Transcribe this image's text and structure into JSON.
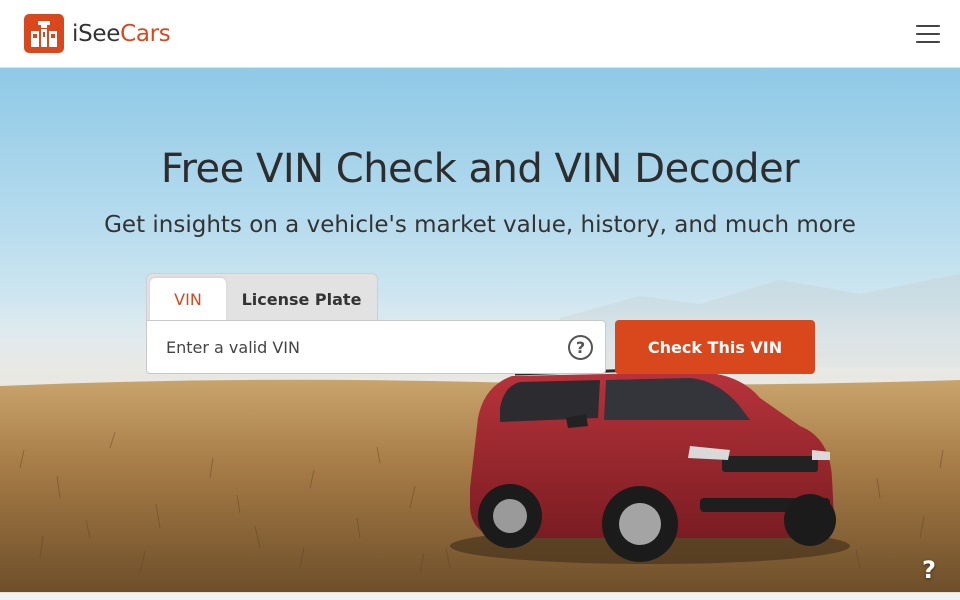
{
  "header": {
    "logo_prefix": "iSee",
    "logo_accent": "Cars",
    "menu_icon": "hamburger-menu-icon"
  },
  "hero": {
    "title": "Free VIN Check and VIN Decoder",
    "subtitle": "Get insights on a vehicle's market value, history, and much more",
    "background": "desert-landscape-with-red-suv"
  },
  "search": {
    "tabs": [
      {
        "label": "VIN",
        "active": true
      },
      {
        "label": "License Plate",
        "active": false
      }
    ],
    "placeholder": "Enter a valid VIN",
    "value": "",
    "help_icon": "question-circle-icon",
    "button_label": "Check This VIN"
  },
  "help_widget": {
    "label": "?"
  },
  "colors": {
    "accent": "#d9481c",
    "text": "#333333",
    "tab_inactive_bg": "#e2e2e2"
  }
}
